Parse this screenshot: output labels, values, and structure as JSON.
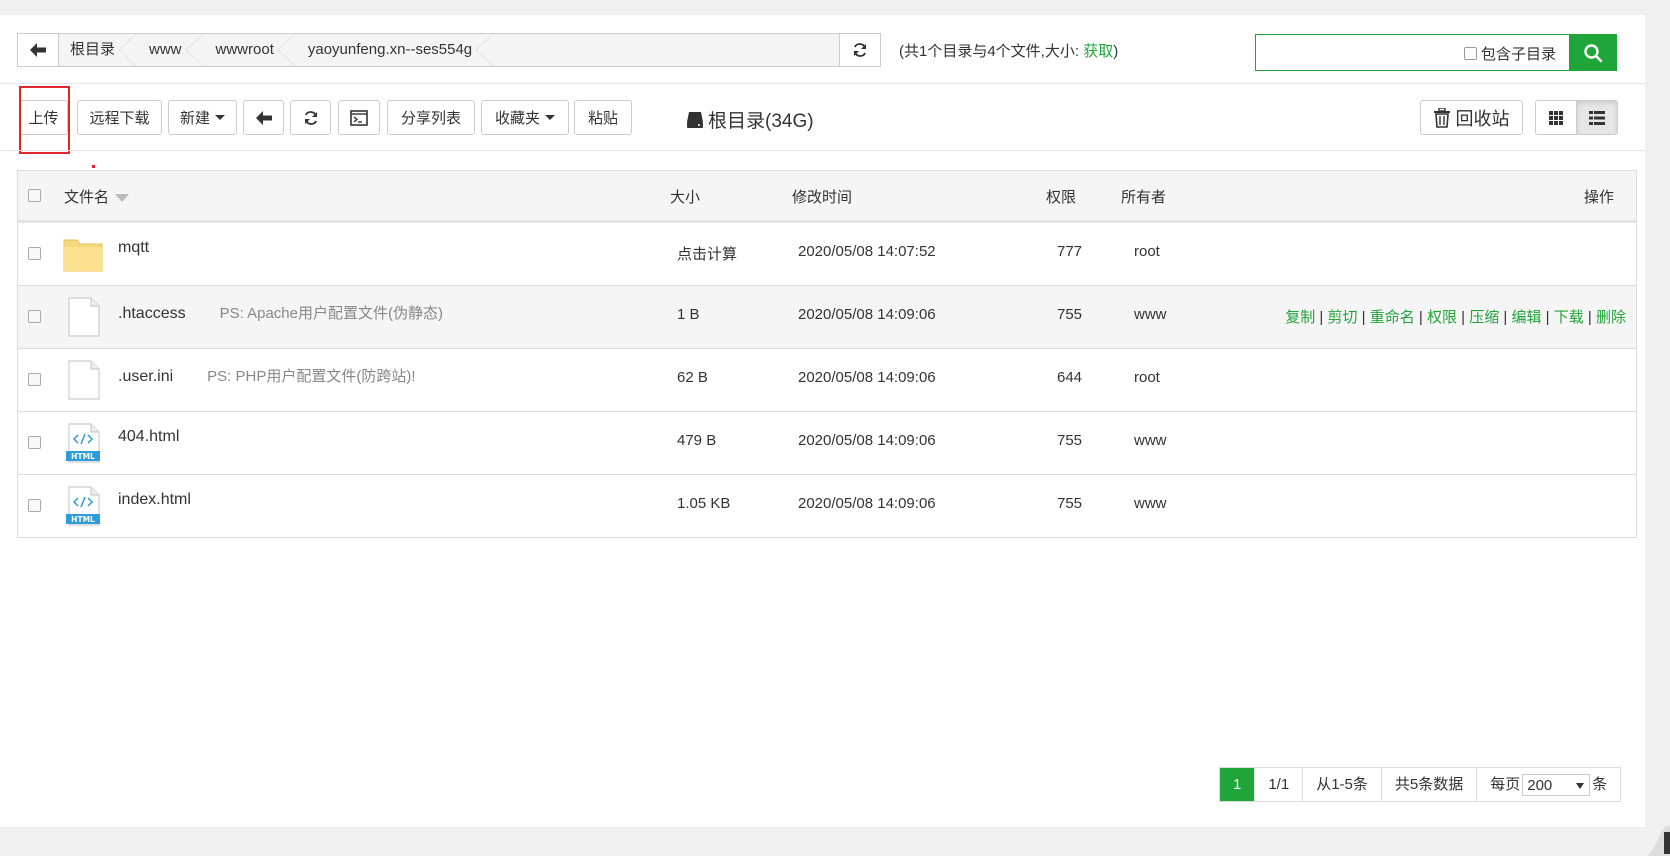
{
  "breadcrumb": [
    "根目录",
    "www",
    "wwwroot",
    "yaoyunfeng.xn--ses554g"
  ],
  "summary": {
    "text": "(共1个目录与4个文件,大小: ",
    "link": "获取",
    "close": ")"
  },
  "search": {
    "value": "",
    "include_sub_label": "包含子目录"
  },
  "toolbar": {
    "upload": "上传",
    "remote_download": "远程下载",
    "new": "新建",
    "share_list": "分享列表",
    "favorites": "收藏夹",
    "paste": "粘贴",
    "disk": "根目录(34G)",
    "recycle": "回收站"
  },
  "table": {
    "headers": {
      "name": "文件名",
      "size": "大小",
      "mtime": "修改时间",
      "perm": "权限",
      "owner": "所有者",
      "ops": "操作"
    },
    "rows": [
      {
        "name": "mqtt",
        "ps": "",
        "size": "点击计算",
        "mtime": "2020/05/08 14:07:52",
        "perm": "777",
        "owner": "root",
        "icon": "folder-icon"
      },
      {
        "name": ".htaccess",
        "ps": "PS: Apache用户配置文件(伪静态)",
        "size": "1 B",
        "mtime": "2020/05/08 14:09:06",
        "perm": "755",
        "owner": "www",
        "icon": "file-icon"
      },
      {
        "name": ".user.ini",
        "ps": "PS: PHP用户配置文件(防跨站)!",
        "size": "62 B",
        "mtime": "2020/05/08 14:09:06",
        "perm": "644",
        "owner": "root",
        "icon": "file-icon"
      },
      {
        "name": "404.html",
        "ps": "",
        "size": "479 B",
        "mtime": "2020/05/08 14:09:06",
        "perm": "755",
        "owner": "www",
        "icon": "html-file-icon"
      },
      {
        "name": "index.html",
        "ps": "",
        "size": "1.05 KB",
        "mtime": "2020/05/08 14:09:06",
        "perm": "755",
        "owner": "www",
        "icon": "html-file-icon"
      }
    ],
    "row_actions": [
      "复制",
      "剪切",
      "重命名",
      "权限",
      "压缩",
      "编辑",
      "下载",
      "删除"
    ]
  },
  "pager": {
    "current": "1",
    "pages": "1/1",
    "range": "从1-5条",
    "total": "共5条数据",
    "per_page_label": "每页",
    "per_page": "200",
    "unit": "条"
  },
  "colors": {
    "accent": "#20a53a",
    "highlight": "#e0252e"
  }
}
